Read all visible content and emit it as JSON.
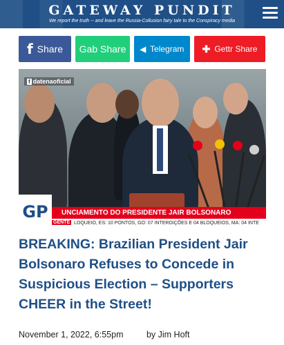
{
  "header": {
    "site_name": "GATEWAY PUNDIT",
    "tagline": "We report the truth -- and leave the Russia-Collusion fairy tale to the Conspiracy media",
    "menu_icon": "hamburger-menu-icon",
    "bg_color": "#1f4f86"
  },
  "share": {
    "facebook": {
      "icon_text": "f",
      "label": "Share",
      "color": "#3b5998"
    },
    "gab": {
      "label": "Gab Share",
      "color": "#21cf7a"
    },
    "telegram": {
      "icon_text": "◀",
      "label": "Telegram",
      "color": "#0088cc"
    },
    "gettr": {
      "icon_text": "✚",
      "label": "Gettr Share",
      "color": "#ee1c25"
    }
  },
  "photo": {
    "watermark": "datenaoficial",
    "watermark_icon": "f",
    "lower_third": "UNCIAMENTO DO PRESIDENTE JAIR BOLSONARO",
    "ticker_tag": "GENTE",
    "ticker_text": "LOQUEIO, ES: 10 PONTOS, GO: 07 INTERDIÇÕES E 04 BLOQUEIOS, MA: 04 INTE",
    "badge": "GP"
  },
  "article": {
    "headline": "BREAKING: Brazilian President Jair Bolsonaro Refuses to Concede in Suspicious Election – Supporters CHEER in the Street!",
    "date": "November 1, 2022, 6:55pm",
    "author": "by Jim Hoft"
  }
}
